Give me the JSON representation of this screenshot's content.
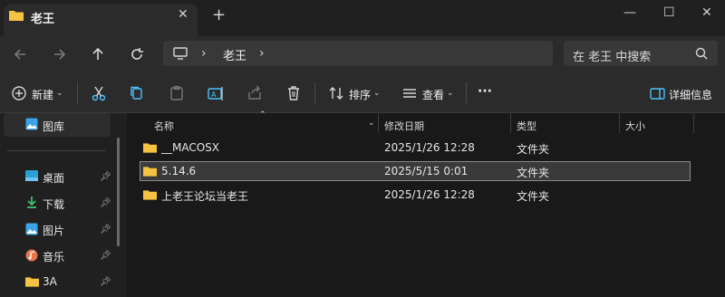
{
  "tab": {
    "title": "老王",
    "close": "✕",
    "new_tab": "+"
  },
  "window": {
    "minimize": "—",
    "maximize": "☐",
    "close": "✕"
  },
  "address": {
    "separator1": "›",
    "crumb": "老王",
    "separator2": "›"
  },
  "search": {
    "placeholder": "在 老王 中搜索"
  },
  "toolbar": {
    "new_label": "新建",
    "sort_label": "排序",
    "view_label": "查看",
    "more": "···",
    "details_label": "详细信息"
  },
  "sidebar": {
    "items": [
      {
        "label": "图库",
        "icon": "gallery-icon"
      },
      {
        "label": "桌面",
        "icon": "desktop-icon",
        "pinned": true
      },
      {
        "label": "下载",
        "icon": "download-icon",
        "pinned": true
      },
      {
        "label": "图片",
        "icon": "pictures-icon",
        "pinned": true
      },
      {
        "label": "音乐",
        "icon": "music-icon",
        "pinned": true
      },
      {
        "label": "3A",
        "icon": "folder-icon",
        "pinned": true
      }
    ]
  },
  "columns": {
    "name": "名称",
    "modified": "修改日期",
    "type": "类型",
    "size": "大小"
  },
  "files": [
    {
      "name": "__MACOSX",
      "modified": "2025/1/26 12:28",
      "type": "文件夹",
      "size": ""
    },
    {
      "name": "5.14.6",
      "modified": "2025/5/15 0:01",
      "type": "文件夹",
      "size": ""
    },
    {
      "name": "上老王论坛当老王",
      "modified": "2025/1/26 12:28",
      "type": "文件夹",
      "size": ""
    }
  ],
  "colors": {
    "folder": "#f5c242",
    "accent": "#4cc2ff",
    "selection": "#3a3a3a"
  }
}
